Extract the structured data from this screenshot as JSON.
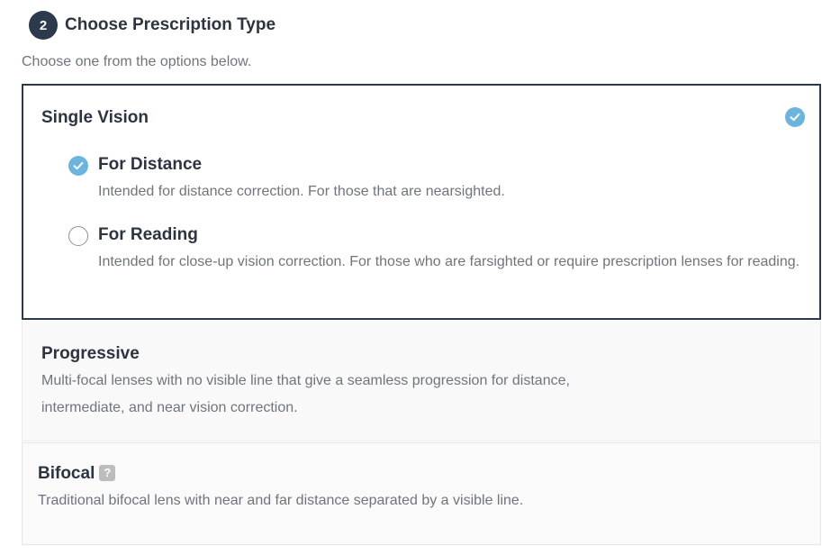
{
  "step": {
    "number": "2",
    "title": "Choose Prescription Type",
    "subtitle": "Choose one from the options below."
  },
  "options": [
    {
      "title": "Single Vision",
      "selected": true,
      "sub_options": [
        {
          "title": "For Distance",
          "description": "Intended for distance correction. For those that are nearsighted.",
          "selected": true
        },
        {
          "title": "For Reading",
          "description": "Intended for close-up vision correction. For those who are farsighted or require prescription lenses for reading.",
          "selected": false
        }
      ]
    },
    {
      "title": "Progressive",
      "description": "Multi-focal lenses with no visible line that give a seamless progression for distance, intermediate, and near vision correction.",
      "selected": false
    },
    {
      "title": "Bifocal",
      "help_label": "?",
      "description": "Traditional bifocal lens with near and far distance separated by a visible line.",
      "selected": false
    }
  ],
  "colors": {
    "accent": "#6ab4de",
    "dark": "#2c3a4b",
    "muted_text": "#6f757c"
  },
  "icons": {
    "selected": "check-circle-icon",
    "unselected": "radio-empty-icon",
    "help": "help-icon"
  }
}
